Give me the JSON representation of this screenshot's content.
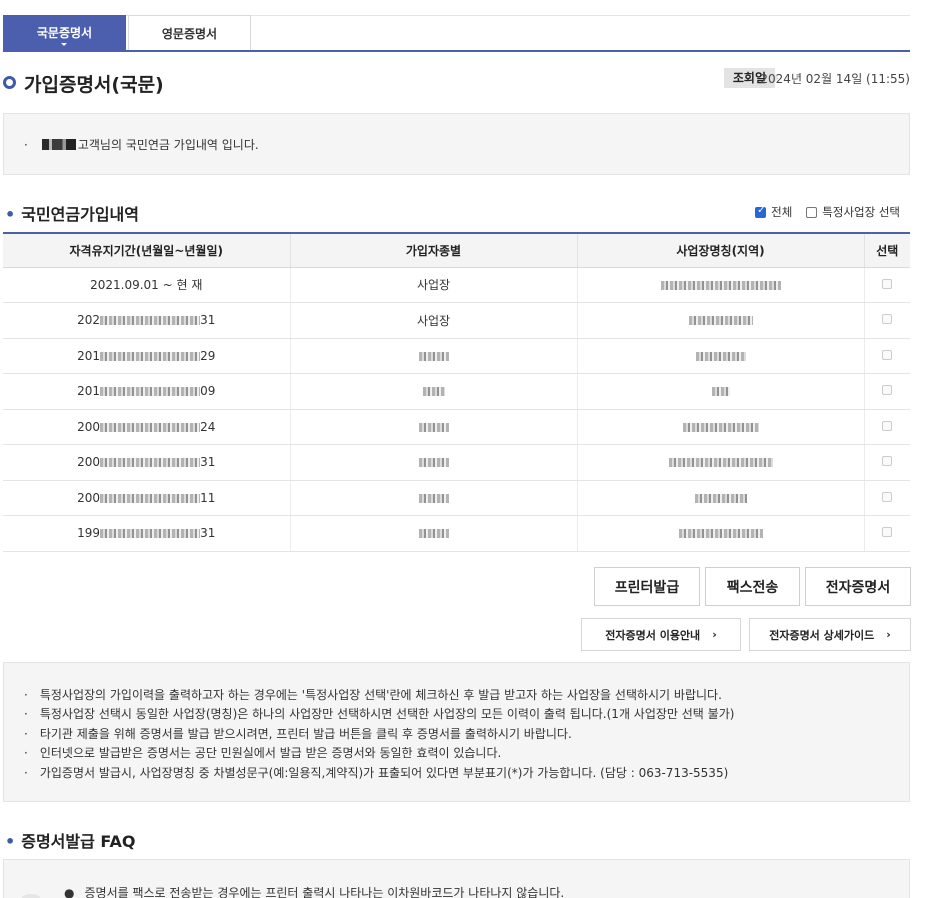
{
  "tabs": {
    "domestic": "국문증명서",
    "english": "영문증명서"
  },
  "header": {
    "title": "가입증명서(국문)",
    "query_label": "조회일",
    "query_date": "2024년 02월 14일 (11:55)"
  },
  "notice": {
    "suffix": "고객님의 국민연금 가입내역 입니다."
  },
  "section1": {
    "title": "국민연금가입내역",
    "option_all": "전체",
    "option_specific": "특정사업장 선택"
  },
  "table": {
    "headers": [
      "자격유지기간(년월일~년월일)",
      "가입자종별",
      "사업장명칭(지역)",
      "선택"
    ],
    "rows": [
      {
        "period": "2021.09.01 ~ 현 재",
        "type": "사업장"
      },
      {
        "period_start": "202",
        "period_end": "31",
        "type": "사업장"
      },
      {
        "period_start": "201",
        "period_end": "29"
      },
      {
        "period_start": "201",
        "period_end": "09"
      },
      {
        "period_start": "200",
        "period_end": "24"
      },
      {
        "period_start": "200",
        "period_end": "31"
      },
      {
        "period_start": "200",
        "period_end": "11"
      },
      {
        "period_start": "199",
        "period_end": "31"
      }
    ]
  },
  "buttons": {
    "print": "프린터발급",
    "fax": "팩스전송",
    "e_cert": "전자증명서"
  },
  "guide_links": {
    "usage": "전자증명서 이용안내",
    "detail": "전자증명서 상세가이드"
  },
  "info_items": [
    "특정사업장의 가입이력을 출력하고자 하는 경우에는 '특정사업장 선택'란에 체크하신 후 발급 받고자 하는 사업장을 선택하시기 바랍니다.",
    "특정사업장 선택시 동일한 사업장(명칭)은 하나의 사업장만 선택하시면 선택한 사업장의 모든 이력이 출력 됩니다.(1개 사업장만 선택 불가)",
    "타기관 제출을 위해 증명서를 발급 받으시려면, 프린터 발급 버튼을 클릭 후 증명서를 출력하시기 바랍니다.",
    "인터넷으로 발급받은 증명서는 공단 민원실에서 발급 받은 증명서와 동일한 효력이 있습니다.",
    "가입증명서 발급시, 사업장명칭 중 차별성문구(예:일용직,계약직)가 표출되어 있다면 부분표기(*)가 가능합니다. (담당 : 063-713-5535)"
  ],
  "section2": {
    "title": "증명서발급 FAQ"
  },
  "faq_items": [
    "증명서를 팩스로 전송받는 경우에는 프린터 출력시 나타나는 이차원바코드가 나타나지 않습니다."
  ],
  "colors": {
    "accent": "#4b5fae",
    "ring": "#3c5ba8",
    "checkbox": "#2566d8"
  }
}
